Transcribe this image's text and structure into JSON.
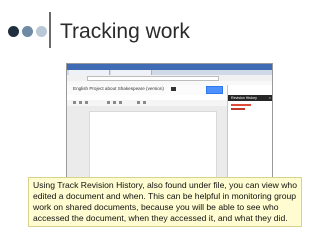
{
  "slide": {
    "title": "Tracking work",
    "dot_colors": [
      "#1f2f3f",
      "#6f8aa4",
      "#b9c8d6"
    ],
    "accent_rule_color": "#6b6b6b"
  },
  "screenshot": {
    "doc_title": "English Project about Shakespeare (version)",
    "panel_title": "Revision History",
    "colors": {
      "window_bar": "#3f6bb5",
      "share_button": "#4d90fe",
      "panel_header": "#262626",
      "revision_highlight": "#dd4b39"
    }
  },
  "caption": {
    "text": "Using Track Revision History, also found under file, you can view who edited a document and when. This can be helpful in monitoring group work on shared documents, because you will be able to see who accessed the document, when they accessed it, and what they did."
  }
}
